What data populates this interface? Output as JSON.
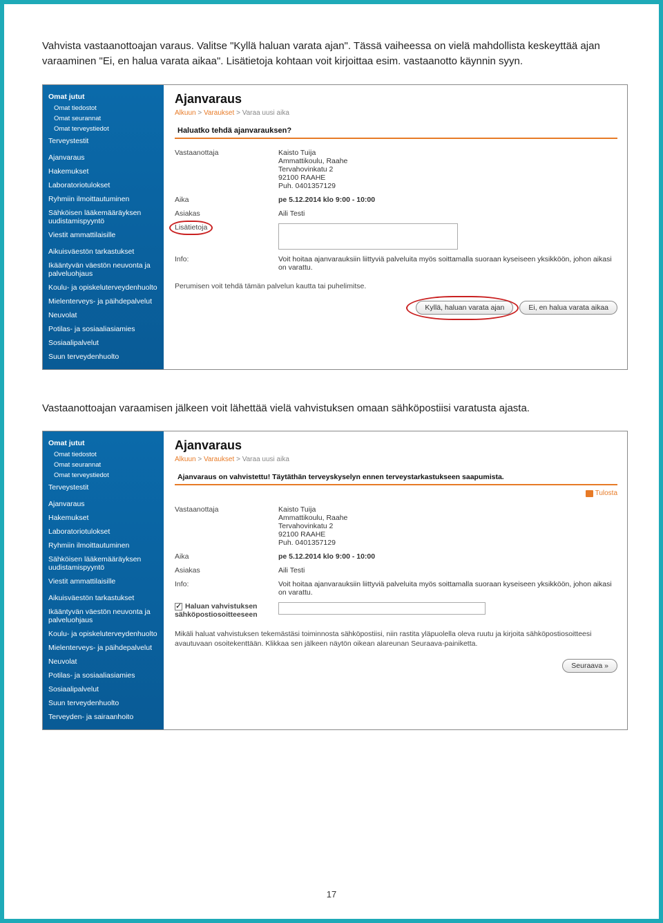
{
  "intro": "Vahvista vastaanottoajan varaus. Valitse \"Kyllä haluan varata ajan\". Tässä vaiheessa on vielä mahdollista keskeyttää ajan varaaminen \"Ei, en halua varata aikaa\". Lisätietoja kohtaan voit kirjoittaa esim. vastaanotto käynnin syyn.",
  "middle": "Vastaanottoajan varaamisen jälkeen voit lähettää vielä vahvistuksen omaan sähköpostiisi varatusta ajasta.",
  "page_number": "17",
  "sidebar": {
    "top_label": "Omat jutut",
    "subs": [
      "Omat tiedostot",
      "Omat seurannat",
      "Omat terveystiedot"
    ],
    "health_tests": "Terveystestit",
    "items1": [
      "Ajanvaraus",
      "Hakemukset",
      "Laboratoriotulokset",
      "Ryhmiin ilmoittautuminen",
      "Sähköisen lääkemääräyksen uudistamispyyntö",
      "Viestit ammattilaisille"
    ],
    "items2": [
      "Aikuisväestön tarkastukset",
      "Ikääntyvän väestön neuvonta ja palveluohjaus",
      "Koulu- ja opiskeluterveydenhuolto",
      "Mielenterveys- ja päihdepalvelut",
      "Neuvolat",
      "Potilas- ja sosiaaliasiamies",
      "Sosiaalipalvelut",
      "Suun terveydenhuolto"
    ],
    "items2b": [
      "Aikuisväestön tarkastukset",
      "Ikääntyvän väestön neuvonta ja palveluohjaus",
      "Koulu- ja opiskeluterveydenhuolto",
      "Mielenterveys- ja päihdepalvelut",
      "Neuvolat",
      "Potilas- ja sosiaaliasiamies",
      "Sosiaalipalvelut",
      "Suun terveydenhuolto",
      "Terveyden- ja sairaanhoito"
    ]
  },
  "shot1": {
    "title": "Ajanvaraus",
    "crumb1": "Alkuun",
    "crumb2": "Varaukset",
    "crumb3": "Varaa uusi aika",
    "section": "Haluatko tehdä ajanvarauksen?",
    "labels": {
      "vast": "Vastaanottaja",
      "aika": "Aika",
      "asiakas": "Asiakas",
      "lisat": "Lisätietoja",
      "info": "Info:"
    },
    "vast_lines": [
      "Kaisto Tuija",
      "Ammattikoulu, Raahe",
      "Tervahovinkatu 2",
      "92100 RAAHE",
      "Puh. 0401357129"
    ],
    "aika_value": "pe 5.12.2014 klo 9:00 - 10:00",
    "asiakas_value": "Aili Testi",
    "info_value": "Voit hoitaa ajanvarauksiin liittyviä palveluita myös soittamalla suoraan kyseiseen yksikköön, johon aikasi on varattu.",
    "cancel_note": "Perumisen voit tehdä tämän palvelun kautta tai puhelimitse.",
    "btn_yes": "Kyllä, haluan varata ajan",
    "btn_no": "Ei, en halua varata aikaa"
  },
  "shot2": {
    "title": "Ajanvaraus",
    "crumb1": "Alkuun",
    "crumb2": "Varaukset",
    "crumb3": "Varaa uusi aika",
    "section": "Ajanvaraus on vahvistettu! Täytäthän terveyskyselyn ennen terveystarkastukseen saapumista.",
    "print": "Tulosta",
    "labels": {
      "vast": "Vastaanottaja",
      "aika": "Aika",
      "asiakas": "Asiakas",
      "info": "Info:",
      "conf": "Haluan vahvistuksen sähköpostiosoitteeseen"
    },
    "vast_lines": [
      "Kaisto Tuija",
      "Ammattikoulu, Raahe",
      "Tervahovinkatu 2",
      "92100 RAAHE",
      "Puh. 0401357129"
    ],
    "aika_value": "pe 5.12.2014 klo 9:00 - 10:00",
    "asiakas_value": "Aili Testi",
    "info_value": "Voit hoitaa ajanvarauksiin liittyviä palveluita myös soittamalla suoraan kyseiseen yksikköön, johon aikasi on varattu.",
    "note": "Mikäli haluat vahvistuksen tekemästäsi toiminnosta sähköpostiisi, niin rastita yläpuolella oleva ruutu ja kirjoita sähköpostiosoitteesi avautuvaan osoitekenttään. Klikkaa sen jälkeen näytön oikean alareunan Seuraava-painiketta.",
    "btn_next": "Seuraava »"
  }
}
